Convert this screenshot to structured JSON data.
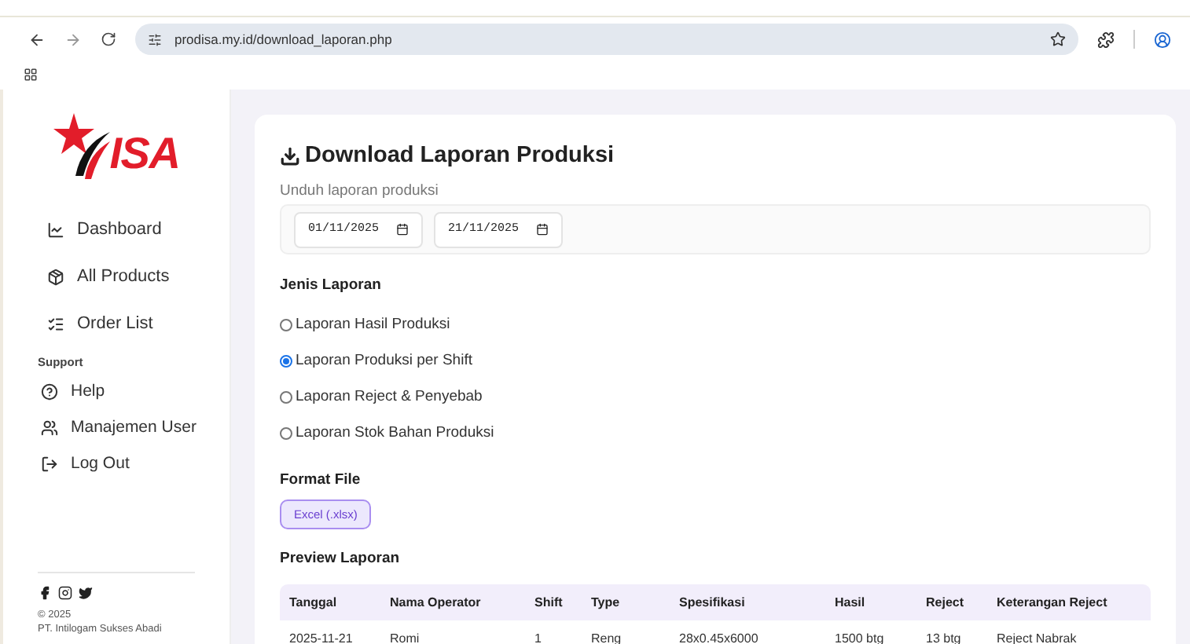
{
  "browser": {
    "url": "prodisa.my.id/download_laporan.php"
  },
  "sidebar": {
    "logo_text": "ISA",
    "items": [
      {
        "label": "Dashboard",
        "kind": "chart"
      },
      {
        "label": "All Products",
        "kind": "box"
      },
      {
        "label": "Order List",
        "kind": "list"
      }
    ],
    "section": "Support",
    "support_items": [
      {
        "label": "Help",
        "kind": "help"
      },
      {
        "label": "Manajemen User",
        "kind": "users"
      },
      {
        "label": "Log Out",
        "kind": "logout"
      }
    ],
    "copyright": "© 2025",
    "company": "PT. Intilogam Sukses Abadi"
  },
  "page": {
    "title": "Download Laporan Produksi",
    "subtitle": "Unduh laporan produksi",
    "date_from": "01/11/2025",
    "date_to": "21/11/2025",
    "report_type_label": "Jenis Laporan",
    "report_types": [
      {
        "label": "Laporan Hasil Produksi",
        "selected": false
      },
      {
        "label": "Laporan Produksi per Shift",
        "selected": true
      },
      {
        "label": "Laporan Reject & Penyebab",
        "selected": false
      },
      {
        "label": "Laporan Stok Bahan Produksi",
        "selected": false
      }
    ],
    "format_label": "Format File",
    "formats": [
      {
        "label": "Excel (.xlsx)",
        "selected": true
      }
    ],
    "preview_label": "Preview Laporan",
    "table": {
      "columns": [
        "Tanggal",
        "Nama Operator",
        "Shift",
        "Type",
        "Spesifikasi",
        "Hasil",
        "Reject",
        "Keterangan Reject"
      ],
      "rows": [
        [
          "2025-11-21",
          "Romi",
          "1",
          "Reng",
          "28x0.45x6000",
          "1500 btg",
          "13 btg",
          "Reject Nabrak"
        ]
      ]
    }
  }
}
